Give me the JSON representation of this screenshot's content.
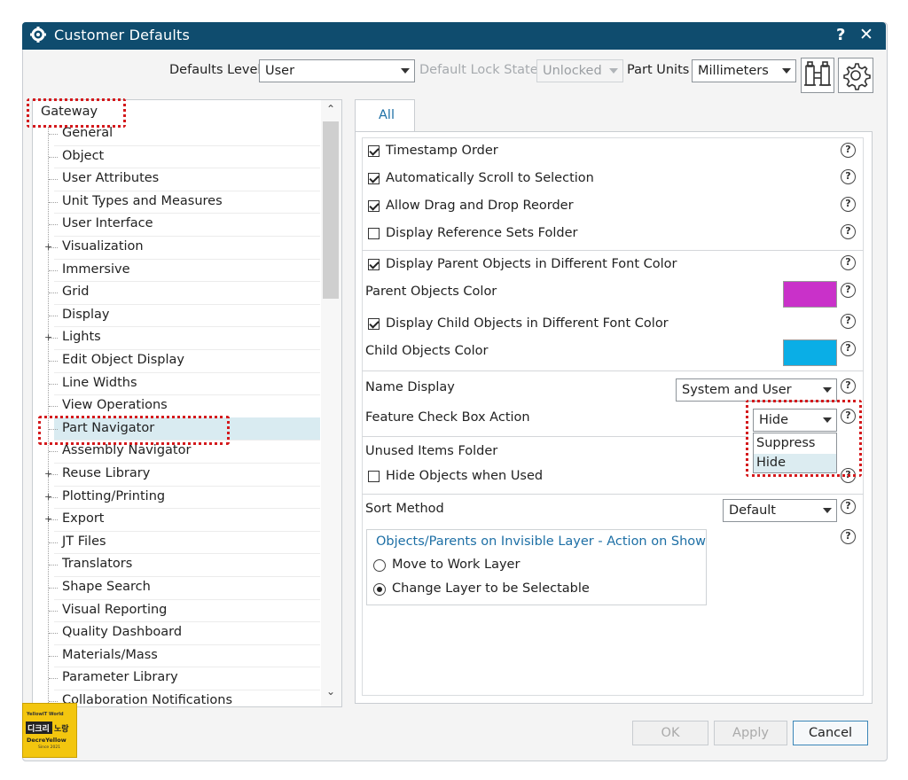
{
  "window": {
    "title": "Customer Defaults",
    "help_glyph": "?",
    "close_glyph": "✕"
  },
  "toolbar": {
    "defaults_level_label": "Defaults Level",
    "defaults_level_value": "User",
    "lock_state_label": "Default Lock State",
    "lock_state_value": "Unlocked",
    "part_units_label": "Part Units",
    "part_units_value": "Millimeters"
  },
  "tree": {
    "root": "Gateway",
    "items": [
      {
        "label": "General",
        "expandable": false
      },
      {
        "label": "Object",
        "expandable": false
      },
      {
        "label": "User Attributes",
        "expandable": false
      },
      {
        "label": "Unit Types and Measures",
        "expandable": false
      },
      {
        "label": "User Interface",
        "expandable": false
      },
      {
        "label": "Visualization",
        "expandable": true
      },
      {
        "label": "Immersive",
        "expandable": false
      },
      {
        "label": "Grid",
        "expandable": false
      },
      {
        "label": "Display",
        "expandable": false
      },
      {
        "label": "Lights",
        "expandable": true
      },
      {
        "label": "Edit Object Display",
        "expandable": false
      },
      {
        "label": "Line Widths",
        "expandable": false
      },
      {
        "label": "View Operations",
        "expandable": false
      },
      {
        "label": "Part Navigator",
        "expandable": false,
        "selected": true
      },
      {
        "label": "Assembly Navigator",
        "expandable": false
      },
      {
        "label": "Reuse Library",
        "expandable": true
      },
      {
        "label": "Plotting/Printing",
        "expandable": true
      },
      {
        "label": "Export",
        "expandable": true
      },
      {
        "label": "JT Files",
        "expandable": false
      },
      {
        "label": "Translators",
        "expandable": false
      },
      {
        "label": "Shape Search",
        "expandable": false
      },
      {
        "label": "Visual Reporting",
        "expandable": false
      },
      {
        "label": "Quality Dashboard",
        "expandable": false
      },
      {
        "label": "Materials/Mass",
        "expandable": false
      },
      {
        "label": "Parameter Library",
        "expandable": false
      },
      {
        "label": "Collaboration Notifications",
        "expandable": false
      }
    ]
  },
  "tabs": [
    {
      "label": "All",
      "active": true
    }
  ],
  "settings": {
    "timestamp_order": "Timestamp Order",
    "auto_scroll": "Automatically Scroll to Selection",
    "allow_drag": "Allow Drag and Drop Reorder",
    "display_ref_sets": "Display Reference Sets Folder",
    "display_parent_color": "Display Parent Objects in Different Font Color",
    "parent_color_label": "Parent Objects Color",
    "parent_color": "#c931c9",
    "display_child_color": "Display Child Objects in Different Font Color",
    "child_color_label": "Child Objects Color",
    "child_color": "#0aaee6",
    "name_display_label": "Name Display",
    "name_display_value": "System and User",
    "feature_checkbox_label": "Feature Check Box Action",
    "feature_checkbox_value": "Hide",
    "feature_checkbox_options": [
      "Suppress",
      "Hide"
    ],
    "unused_items_label": "Unused Items Folder",
    "hide_objects_label": "Hide Objects when Used",
    "sort_method_label": "Sort Method",
    "sort_method_value": "Default",
    "group_title": "Objects/Parents on Invisible Layer - Action on Show",
    "radio_move": "Move to Work Layer",
    "radio_change": "Change Layer to be Selectable"
  },
  "buttons": {
    "ok": "OK",
    "apply": "Apply",
    "cancel": "Cancel"
  },
  "watermark": {
    "line1": "YellowIT World",
    "line2a": "디크리",
    "line2b": "노랑",
    "line3": "DecreYellow",
    "line4": "Since 2021"
  },
  "colors": {
    "titlebar": "#0f4c6e",
    "accent": "#1d6fa5",
    "highlight": "#d4191c"
  }
}
